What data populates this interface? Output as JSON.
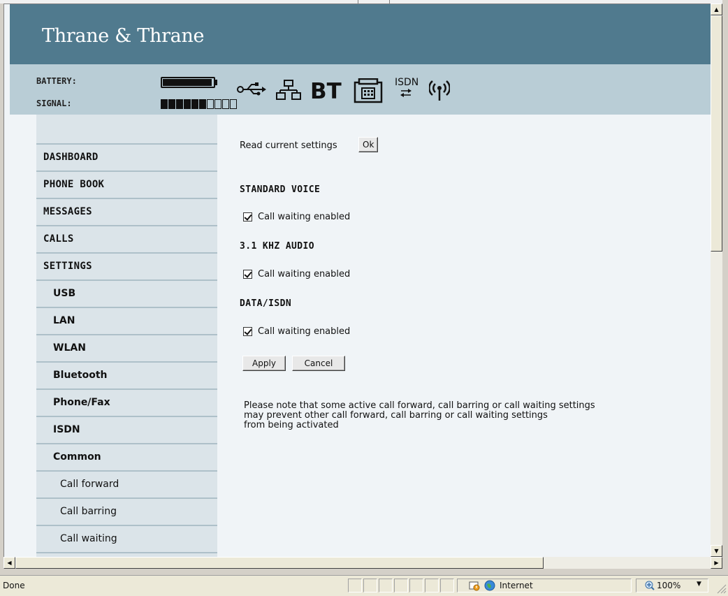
{
  "header": {
    "brand": "Thrane & Thrane"
  },
  "status": {
    "battery_label": "BATTERY:",
    "signal_label": "SIGNAL:",
    "signal_bars_filled": 6,
    "signal_bars_total": 10,
    "battery_level": 1.0
  },
  "interface_icons": [
    "usb-icon",
    "lan-icon",
    "bluetooth-icon",
    "phone-fax-icon",
    "isdn-icon",
    "wlan-icon"
  ],
  "icon_text": {
    "bt": "BT",
    "isdn": "ISDN"
  },
  "nav": {
    "items": [
      {
        "label": "DASHBOARD",
        "level": 0
      },
      {
        "label": "PHONE BOOK",
        "level": 0
      },
      {
        "label": "MESSAGES",
        "level": 0
      },
      {
        "label": "CALLS",
        "level": 0
      },
      {
        "label": "SETTINGS",
        "level": 0
      },
      {
        "label": "USB",
        "level": 1
      },
      {
        "label": "LAN",
        "level": 1
      },
      {
        "label": "WLAN",
        "level": 1
      },
      {
        "label": "Bluetooth",
        "level": 1
      },
      {
        "label": "Phone/Fax",
        "level": 1
      },
      {
        "label": "ISDN",
        "level": 1
      },
      {
        "label": "Common",
        "level": 1
      },
      {
        "label": "Call forward",
        "level": 2
      },
      {
        "label": "Call barring",
        "level": 2
      },
      {
        "label": "Call waiting",
        "level": 2
      }
    ]
  },
  "content": {
    "read_settings_label": "Read current settings",
    "ok_label": "Ok",
    "sections": [
      {
        "heading": "STANDARD VOICE",
        "checkbox_label": "Call waiting enabled",
        "checked": true
      },
      {
        "heading": "3.1 KHZ AUDIO",
        "checkbox_label": "Call waiting enabled",
        "checked": true
      },
      {
        "heading": "DATA/ISDN",
        "checkbox_label": "Call waiting enabled",
        "checked": true
      }
    ],
    "apply_label": "Apply",
    "cancel_label": "Cancel",
    "note": "Please note that some active call forward, call barring or call waiting settings\nmay prevent other call forward, call barring or call waiting settings\nfrom being activated"
  },
  "statusbar": {
    "status_text": "Done",
    "zone_text": "Internet",
    "zoom_text": "100%"
  }
}
